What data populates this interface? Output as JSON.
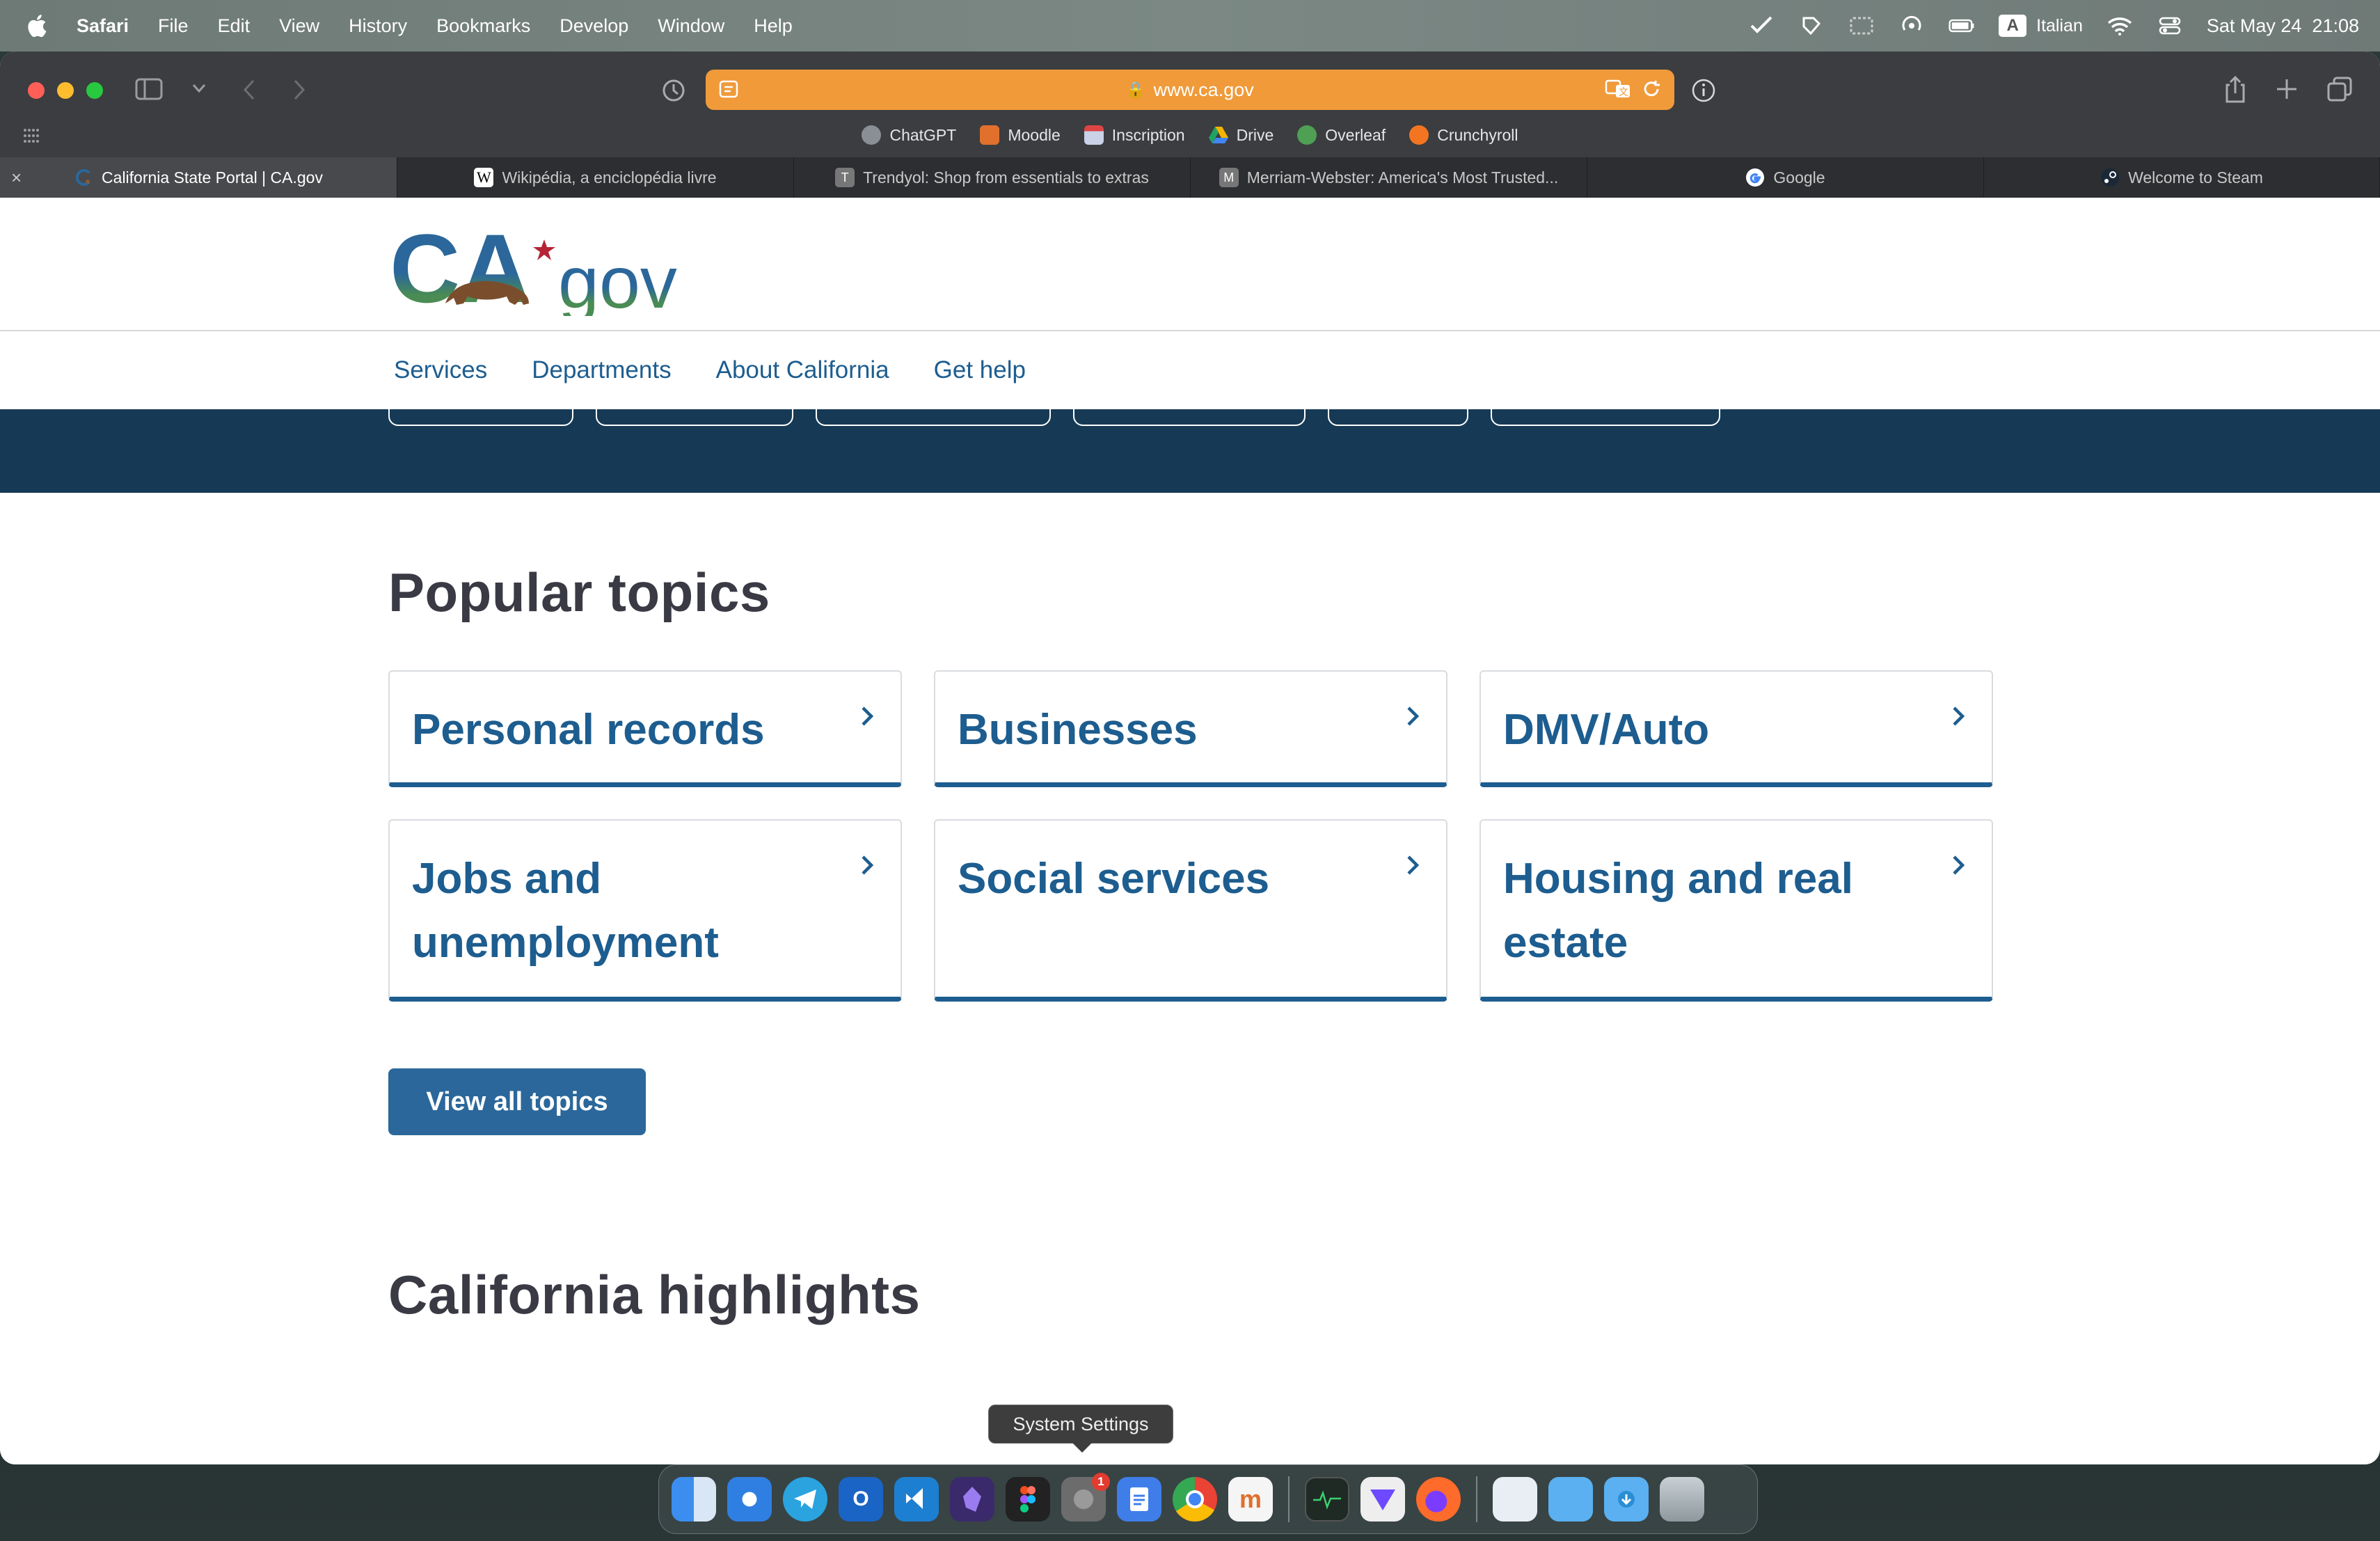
{
  "menubar": {
    "app_name": "Safari",
    "items": [
      "File",
      "Edit",
      "View",
      "History",
      "Bookmarks",
      "Develop",
      "Window",
      "Help"
    ],
    "input_source_letter": "A",
    "input_source": "Italian",
    "datetime": "Sat May 24  21:08"
  },
  "browser": {
    "url": "www.ca.gov",
    "bookmarks": [
      {
        "label": "ChatGPT",
        "color": "#8a8f95"
      },
      {
        "label": "Moodle",
        "color": "#e0702c"
      },
      {
        "label": "Inscription",
        "color": "#c9d2e6"
      },
      {
        "label": "Drive",
        "color": "#2f9e5b"
      },
      {
        "label": "Overleaf",
        "color": "#4f9f55"
      },
      {
        "label": "Crunchyroll",
        "color": "#f47521"
      }
    ],
    "tabs": [
      {
        "label": "California State Portal | CA.gov",
        "active": true,
        "fav_color": "#2b679a"
      },
      {
        "label": "Wikipédia, a enciclopédia livre",
        "active": false,
        "fav_color": "#ffffff",
        "fav_text": "W"
      },
      {
        "label": "Trendyol: Shop from essentials to extras",
        "active": false,
        "fav_color": "#777777",
        "fav_text": "T"
      },
      {
        "label": "Merriam-Webster: America's Most Trusted...",
        "active": false,
        "fav_color": "#777777",
        "fav_text": "M"
      },
      {
        "label": "Google",
        "active": false,
        "fav_color": "#ffffff",
        "fav_text": "G"
      },
      {
        "label": "Welcome to Steam",
        "active": false,
        "fav_color": "#1b2838"
      }
    ]
  },
  "site": {
    "logo_ca": "CA",
    "logo_gov": "gov",
    "nav": [
      "Services",
      "Departments",
      "About California",
      "Get help"
    ],
    "popular_heading": "Popular topics",
    "topics": [
      "Personal records",
      "Businesses",
      "DMV/Auto",
      "Jobs and unemployment",
      "Social services",
      "Housing and real estate"
    ],
    "view_all": "View all topics",
    "highlights_heading": "California highlights"
  },
  "dock": {
    "tooltip": "System Settings",
    "settings_badge": "1",
    "apps": [
      {
        "name": "Finder",
        "color": "#3b8ef0"
      },
      {
        "name": "Safari",
        "color": "#2f7fe3"
      },
      {
        "name": "Telegram",
        "color": "#2aa3df"
      },
      {
        "name": "Outlook",
        "color": "#1a64c5"
      },
      {
        "name": "VS Code",
        "color": "#1d7fd1"
      },
      {
        "name": "Obsidian",
        "color": "#3b2a6b"
      },
      {
        "name": "Figma",
        "color": "#222222"
      },
      {
        "name": "System Settings",
        "color": "#6c6c6c"
      },
      {
        "name": "Docs",
        "color": "#3f7ee8"
      },
      {
        "name": "Chrome",
        "color": "#e8e8e8"
      },
      {
        "name": "Moodle",
        "color": "#f5f5f5"
      },
      {
        "name": "Activity Monitor",
        "color": "#1f2a24"
      },
      {
        "name": "Proton VPN",
        "color": "#eeeeee"
      },
      {
        "name": "Firefox",
        "color": "#ff6b2a"
      },
      {
        "name": "Documents",
        "color": "#e9eef5"
      },
      {
        "name": "Folder",
        "color": "#5ab0f0"
      },
      {
        "name": "Downloads",
        "color": "#5ab0f0"
      },
      {
        "name": "Trash",
        "color": "#9aa4aa"
      }
    ]
  }
}
